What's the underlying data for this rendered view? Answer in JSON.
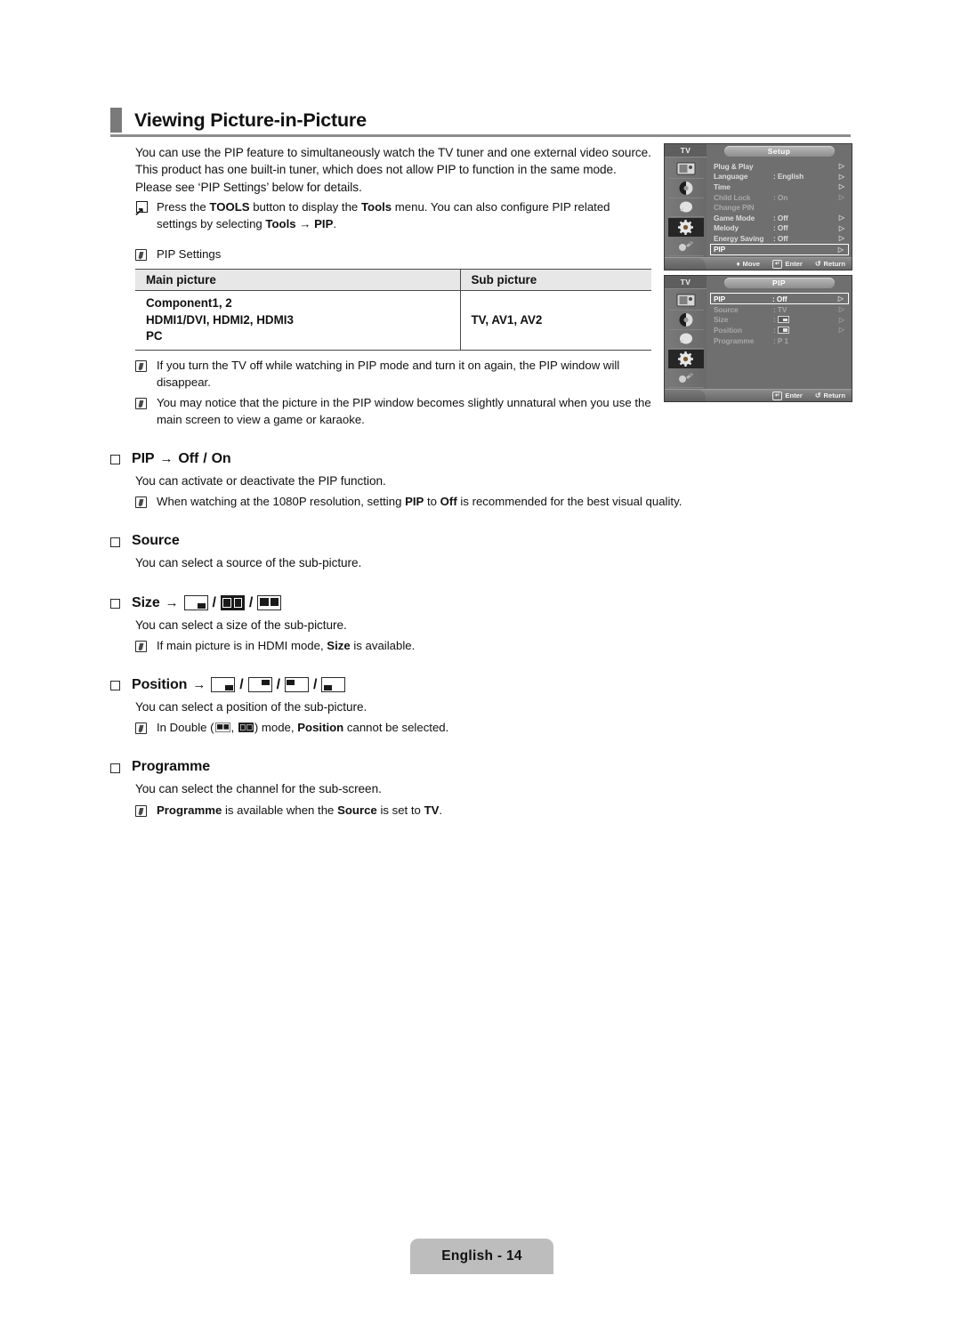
{
  "page": {
    "title": "Viewing Picture-in-Picture",
    "footer_label": "English - 14"
  },
  "intro": {
    "paragraph": "You can use the PIP feature to simultaneously watch the TV tuner and one external video source. This product has one built-in tuner, which does not allow PIP to function in the same mode. Please see ‘PIP Settings’ below for details.",
    "tools_note_1": "Press the ",
    "tools_note_bold_1": "TOOLS",
    "tools_note_2": " button to display the ",
    "tools_note_bold_2": "Tools",
    "tools_note_3": " menu. You can also configure PIP related settings by selecting ",
    "tools_note_bold_3": "Tools",
    "tools_note_arrow": " → ",
    "tools_note_bold_4": "PIP",
    "tools_note_4": "."
  },
  "pip_settings": {
    "label": "PIP Settings",
    "table": {
      "headers": [
        "Main picture",
        "Sub picture"
      ],
      "main_lines": [
        "Component1, 2",
        "HDMI1/DVI, HDMI2, HDMI3",
        "PC"
      ],
      "sub_value": "TV, AV1, AV2"
    },
    "notes": [
      "If you turn the TV off while watching in PIP mode and turn it on again, the PIP window will disappear.",
      "You may notice that the picture in the PIP window becomes slightly unnatural when you use the main screen to view a game or karaoke."
    ]
  },
  "sections": {
    "pip": {
      "title_main": "PIP",
      "title_arrow": "→",
      "title_opt1": "Off",
      "title_slash": "/",
      "title_opt2": "On",
      "body": "You can activate or deactivate the PIP function.",
      "note_a": "When watching at the 1080P resolution, setting ",
      "note_b": "PIP",
      "note_c": " to ",
      "note_d": "Off",
      "note_e": " is recommended for the best visual quality."
    },
    "source": {
      "title": "Source",
      "body": "You can select a source of the sub-picture."
    },
    "size": {
      "title": "Size",
      "title_arrow": "→",
      "icons": [
        "size-single-icon",
        "size-double-solid-icon",
        "size-double-outline-icon"
      ],
      "body": "You can select a size of the sub-picture.",
      "note_a": "If main picture is in HDMI mode, ",
      "note_b": "Size",
      "note_c": " is available."
    },
    "position": {
      "title": "Position",
      "title_arrow": "→",
      "icons": [
        "position-bottom-right-icon",
        "position-top-right-icon",
        "position-top-left-icon",
        "position-bottom-left-icon"
      ],
      "body": "You can select a position of the sub-picture.",
      "note_a": "In Double (",
      "note_sep": ", ",
      "note_b": ") mode, ",
      "note_c": "Position",
      "note_d": " cannot be selected."
    },
    "programme": {
      "title": "Programme",
      "body": "You can select the channel for the sub-screen.",
      "note_a": "Programme",
      "note_b": " is available when the ",
      "note_c": "Source",
      "note_d": " is set to ",
      "note_e": "TV",
      "note_f": "."
    }
  },
  "osd_setup": {
    "tv_label": "TV",
    "menu_title": "Setup",
    "rows": [
      {
        "name": "Plug & Play",
        "value": "",
        "arrow": "▷",
        "dim": false,
        "highlight": false
      },
      {
        "name": "Language",
        "value": ": English",
        "arrow": "▷",
        "dim": false,
        "highlight": false
      },
      {
        "name": "Time",
        "value": "",
        "arrow": "▷",
        "dim": false,
        "highlight": false
      },
      {
        "name": "Child Lock",
        "value": ": On",
        "arrow": "▷",
        "dim": true,
        "highlight": false
      },
      {
        "name": "Change PIN",
        "value": "",
        "arrow": "",
        "dim": true,
        "highlight": false
      },
      {
        "name": "Game Mode",
        "value": ": Off",
        "arrow": "▷",
        "dim": false,
        "highlight": false
      },
      {
        "name": "Melody",
        "value": ": Off",
        "arrow": "▷",
        "dim": false,
        "highlight": false
      },
      {
        "name": "Energy Saving",
        "value": ": Off",
        "arrow": "▷",
        "dim": false,
        "highlight": false
      },
      {
        "name": "PIP",
        "value": "",
        "arrow": "▷",
        "dim": false,
        "highlight": true
      }
    ],
    "buttons": [
      {
        "key": "♦",
        "label": "Move"
      },
      {
        "key": "↵",
        "label": "Enter"
      },
      {
        "key": "↺",
        "label": "Return"
      }
    ]
  },
  "osd_pip": {
    "tv_label": "TV",
    "menu_title": "PIP",
    "rows": [
      {
        "name": "PIP",
        "value": ": Off",
        "arrow": "▷",
        "dim": false,
        "highlight": true,
        "box": false
      },
      {
        "name": "Source",
        "value": ": TV",
        "arrow": "▷",
        "dim": true,
        "highlight": false,
        "box": false
      },
      {
        "name": "Size",
        "value": ": ",
        "arrow": "▷",
        "dim": true,
        "highlight": false,
        "box": true
      },
      {
        "name": "Position",
        "value": ": ",
        "arrow": "▷",
        "dim": true,
        "highlight": false,
        "box": true
      },
      {
        "name": "Programme",
        "value": ": P 1",
        "arrow": "",
        "dim": true,
        "highlight": false,
        "box": false
      }
    ],
    "buttons": [
      {
        "key": "↵",
        "label": "Enter"
      },
      {
        "key": "↺",
        "label": "Return"
      }
    ]
  },
  "colors": {
    "title_bullet": "#7a7a7a",
    "rule": "#8d8d8d",
    "table_header_bg": "#e7e7e7",
    "osd_bg": "#6f6f6f",
    "footer_bg": "#bdbdbd"
  }
}
